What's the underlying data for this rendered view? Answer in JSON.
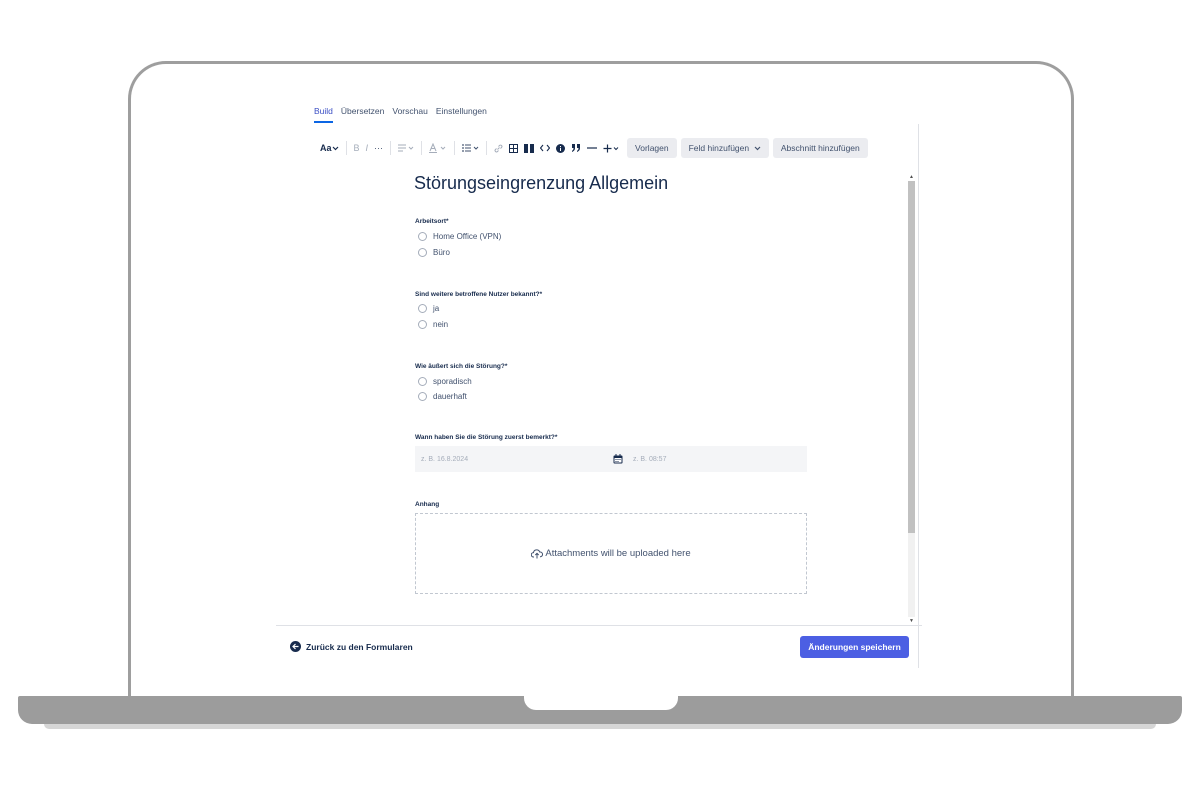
{
  "tabs": [
    {
      "label": "Build",
      "active": true
    },
    {
      "label": "Übersetzen"
    },
    {
      "label": "Vorschau"
    },
    {
      "label": "Einstellungen"
    }
  ],
  "toolbar": {
    "text_style": "Aa",
    "bold": "B",
    "italic": "I",
    "more": "···",
    "templates_label": "Vorlagen",
    "add_field_label": "Feld hinzufügen",
    "add_section_label": "Abschnitt hinzufügen"
  },
  "form": {
    "title": "Störungseingrenzung Allgemein",
    "fields": [
      {
        "label": "Arbeitsort*",
        "options": [
          "Home Office (VPN)",
          "Büro"
        ]
      },
      {
        "label": "Sind weitere betroffene Nutzer bekannt?*",
        "options": [
          "ja",
          "nein"
        ]
      },
      {
        "label": "Wie äußert sich die Störung?*",
        "options": [
          "sporadisch",
          "dauerhaft"
        ]
      }
    ],
    "datetime": {
      "label": "Wann haben Sie die Störung zuerst bemerkt?*",
      "date_placeholder": "z. B. 16.8.2024",
      "time_placeholder": "z. B. 08:57"
    },
    "attachment": {
      "label": "Anhang",
      "dropzone_text": "Attachments will be uploaded here"
    }
  },
  "footer": {
    "back_label": "Zurück zu den Formularen",
    "save_label": "Änderungen speichern"
  },
  "colors": {
    "accent": "#4c5fe3",
    "text": "#172b4d"
  }
}
